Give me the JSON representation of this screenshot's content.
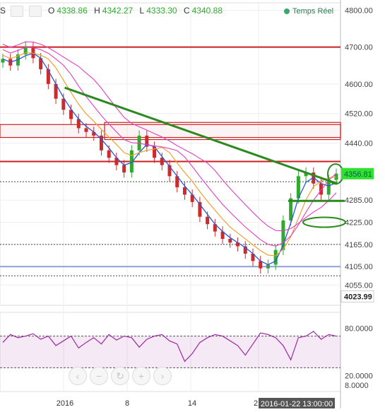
{
  "header": {
    "symbol_fragment": "S",
    "open_label": "O",
    "open": "4338.86",
    "high_label": "H",
    "high": "4342.27",
    "low_label": "L",
    "low": "4333.30",
    "close_label": "C",
    "close": "4340.88",
    "realtime_label": "Temps Réel"
  },
  "colors": {
    "up": "#2eaa2e",
    "down": "#cc2b2b",
    "trend": "#2a8a1e",
    "resistance": "#cc1f1f",
    "support_blue": "#8fa0d8",
    "ema_magenta": "#e040c0",
    "ema_blue": "#2a55d8",
    "ema_orange": "#f0a030",
    "rsi": "#9a2aa0"
  },
  "toolbar_icons": [
    "box-icon",
    "settings-icon"
  ],
  "nav_icons": [
    "back-icon",
    "undo-icon",
    "refresh-icon",
    "zoom-in-icon",
    "forward-icon"
  ],
  "chart_data": {
    "type": "candlestick",
    "price_axis": {
      "ticks": [
        "4800.00",
        "4700.00",
        "4600.00",
        "4520.00",
        "4440.00",
        "4285.00",
        "4225.00",
        "4165.00",
        "4105.00",
        "4055.00"
      ],
      "ylim": [
        4000,
        4820
      ]
    },
    "current_price_label": "4356.81",
    "extra_price_label": "4023.99",
    "x_labels": [
      "2016",
      "8",
      "14",
      "2"
    ],
    "crosshair_time": "2016-01-22 13:00:00",
    "horizontal_levels": [
      {
        "price": 4700,
        "style": "solid",
        "color": "resistance"
      },
      {
        "price": 4390,
        "style": "solid",
        "color": "resistance"
      },
      {
        "price": 4105,
        "style": "solid",
        "color": "support_blue"
      },
      {
        "price": 4335,
        "style": "dotted",
        "color": "black"
      },
      {
        "price": 4165,
        "style": "dotted",
        "color": "black"
      },
      {
        "price": 4080,
        "style": "dotted",
        "color": "black"
      }
    ],
    "zone": {
      "from": 4455,
      "to": 4490
    },
    "trendline": {
      "from": {
        "x": 0.19,
        "price": 4590
      },
      "to": {
        "x": 0.99,
        "price": 4330
      }
    },
    "price_series": [
      4668,
      4650,
      4680,
      4700,
      4670,
      4640,
      4600,
      4560,
      4530,
      4505,
      4480,
      4470,
      4460,
      4420,
      4400,
      4380,
      4360,
      4420,
      4460,
      4430,
      4400,
      4380,
      4350,
      4320,
      4300,
      4280,
      4240,
      4220,
      4200,
      4180,
      4170,
      4160,
      4140,
      4120,
      4100,
      4110,
      4150,
      4230,
      4290,
      4350,
      4360,
      4330,
      4300,
      4340,
      4356.81
    ],
    "rsi": {
      "ticks": [
        "80.0000",
        "20.0000",
        "8.0000"
      ],
      "ylim": [
        0,
        100
      ],
      "levels": [
        70,
        30
      ],
      "values": [
        62,
        72,
        68,
        70,
        73,
        66,
        70,
        58,
        64,
        70,
        55,
        62,
        68,
        60,
        72,
        65,
        70,
        68,
        56,
        66,
        70,
        72,
        64,
        60,
        38,
        48,
        62,
        68,
        72,
        70,
        64,
        58,
        46,
        60,
        74,
        72,
        68,
        58,
        40,
        68,
        70,
        76,
        66,
        72,
        70
      ]
    }
  }
}
